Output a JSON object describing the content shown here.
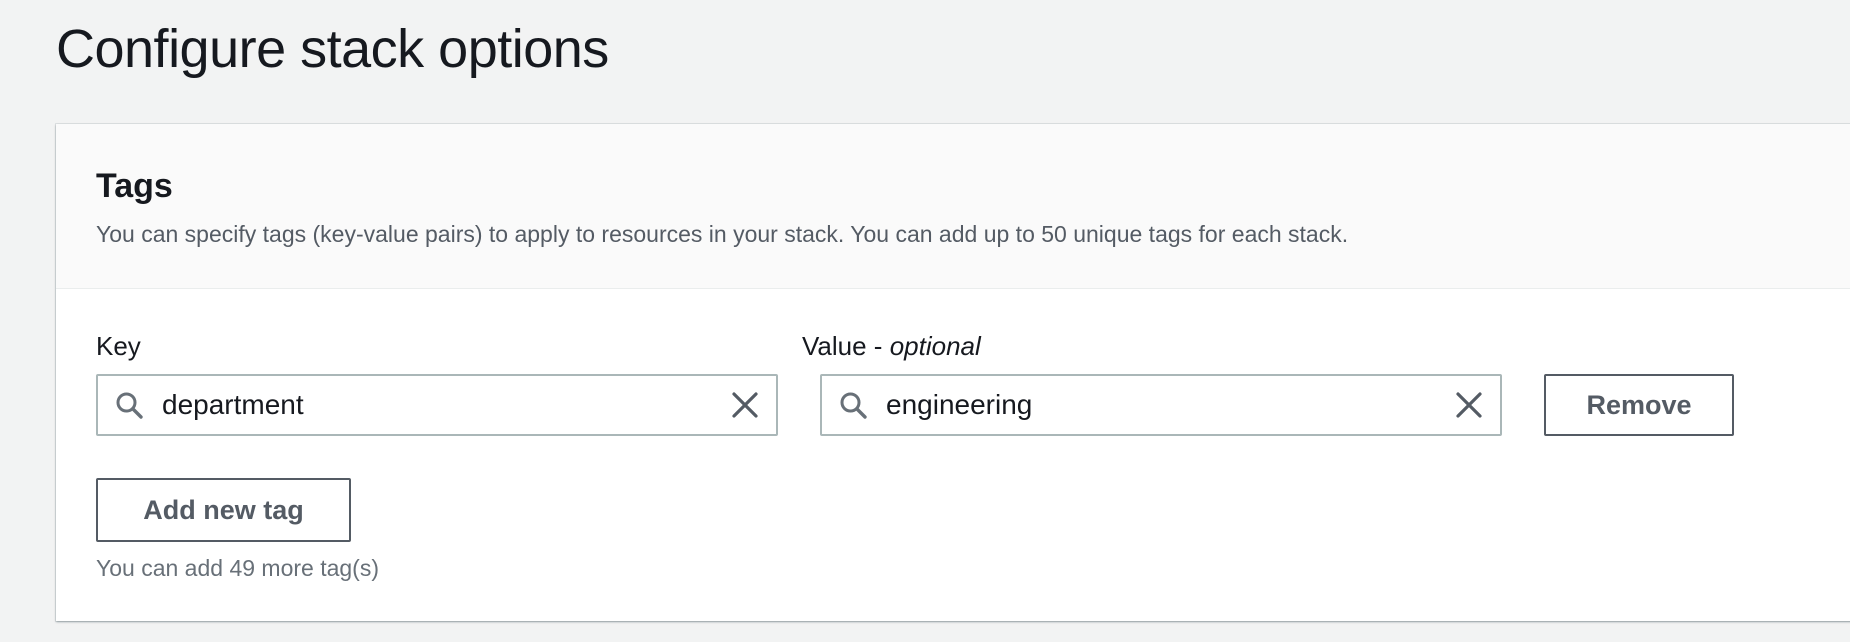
{
  "page": {
    "title": "Configure stack options"
  },
  "tags_panel": {
    "title": "Tags",
    "description": "You can specify tags (key-value pairs) to apply to resources in your stack. You can add up to 50 unique tags for each stack.",
    "key_label": "Key",
    "value_label_prefix": "Value - ",
    "value_label_optional": "optional",
    "tags": [
      {
        "key": "department",
        "value": "engineering"
      }
    ],
    "remove_label": "Remove",
    "add_label": "Add new tag",
    "remaining_text": "You can add 49 more tag(s)"
  },
  "icons": {
    "search": "search-icon",
    "clear": "close-icon"
  },
  "colors": {
    "page_bg": "#f2f3f3",
    "panel_bg": "#ffffff",
    "header_bg": "#fafafa",
    "text": "#16191f",
    "secondary_text": "#545b64",
    "input_border": "#aab7b8"
  }
}
